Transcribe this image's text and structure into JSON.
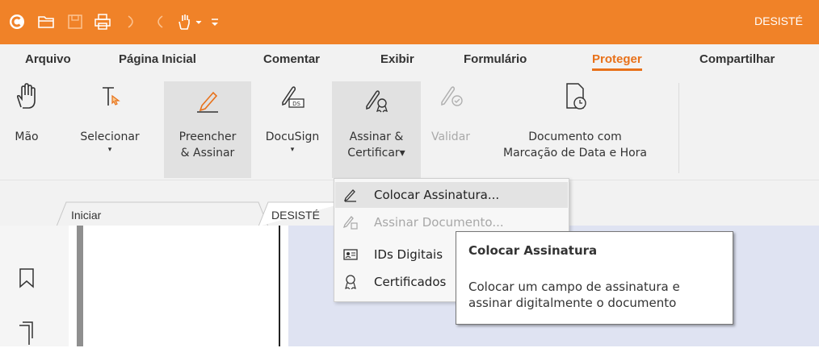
{
  "title_bar": {
    "document_title": "DESISTÉ",
    "quick_access": [
      "app-logo-icon",
      "open-folder-icon",
      "save-icon",
      "print-icon",
      "undo-icon",
      "redo-icon",
      "hand-tool-icon",
      "customize-icon"
    ]
  },
  "menu_tabs": [
    {
      "label": "Arquivo"
    },
    {
      "label": "Página Inicial"
    },
    {
      "label": "Comentar"
    },
    {
      "label": "Exibir"
    },
    {
      "label": "Formulário"
    },
    {
      "label": "Proteger",
      "active": true
    },
    {
      "label": "Compartilhar"
    }
  ],
  "ribbon": {
    "hand": {
      "label": "Mão"
    },
    "select": {
      "label": "Selecionar",
      "caret": "▾"
    },
    "fill_sign": {
      "label_line1": "Preencher",
      "label_line2": "& Assinar"
    },
    "docusign": {
      "label": "DocuSign",
      "caret": "▾"
    },
    "sign_certify": {
      "label_line1": "Assinar &",
      "label_line2": "Certificar▾"
    },
    "validate": {
      "label": "Validar"
    },
    "timestamp": {
      "label_line1": "Documento com",
      "label_line2": "Marcação de Data e Hora"
    }
  },
  "doc_tabs": [
    {
      "label": "Iniciar"
    },
    {
      "label": "DESISTÉ"
    }
  ],
  "dropdown": {
    "items": [
      {
        "label": "Colocar Assinatura...",
        "icon": "pen-signature-icon",
        "highlighted": true
      },
      {
        "label": "Assinar Documento...",
        "icon": "sign-document-icon",
        "disabled": true
      },
      {
        "label": "IDs Digitais",
        "icon": "digital-id-icon"
      },
      {
        "label": "Certificados",
        "icon": "certificate-icon"
      }
    ]
  },
  "tooltip": {
    "title": "Colocar Assinatura",
    "description": "Colocar um campo de assinatura e assinar digitalmente o documento"
  },
  "left_nav": [
    "bookmark-icon",
    "pages-icon"
  ],
  "colors": {
    "brand": "#f08228",
    "active_tab": "#e8711a",
    "ribbon_bg": "#f2f2f2",
    "doc_area": "#dfe3f2"
  }
}
